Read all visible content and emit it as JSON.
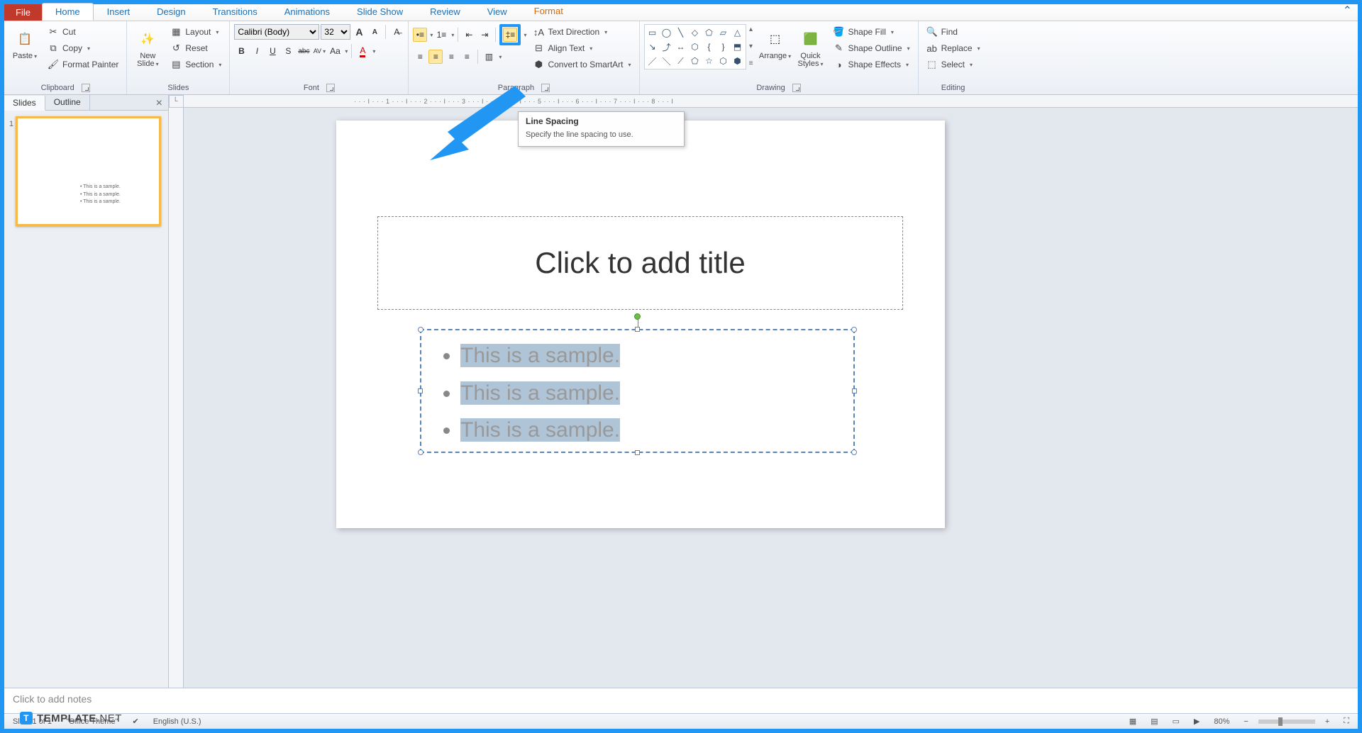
{
  "tabs": {
    "file": "File",
    "home": "Home",
    "insert": "Insert",
    "design": "Design",
    "transitions": "Transitions",
    "animations": "Animations",
    "slideshow": "Slide Show",
    "review": "Review",
    "view": "View",
    "format": "Format"
  },
  "clipboard": {
    "paste": "Paste",
    "cut": "Cut",
    "copy": "Copy",
    "format_painter": "Format Painter",
    "group": "Clipboard"
  },
  "slides": {
    "new_slide": "New\nSlide",
    "layout": "Layout",
    "reset": "Reset",
    "section": "Section",
    "group": "Slides"
  },
  "font": {
    "name": "Calibri (Body)",
    "size": "32",
    "grow": "A",
    "shrink": "A",
    "clear": "Aa",
    "bold": "B",
    "italic": "I",
    "underline": "U",
    "strike": "S",
    "strike2": "abc",
    "spacing": "AV",
    "case": "Aa",
    "color": "A",
    "group": "Font"
  },
  "paragraph": {
    "group": "Paragraph",
    "text_direction": "Text Direction",
    "align_text": "Align Text",
    "convert_smartart": "Convert to SmartArt"
  },
  "drawing": {
    "group": "Drawing",
    "arrange": "Arrange",
    "quick_styles": "Quick\nStyles",
    "shape_fill": "Shape Fill",
    "shape_outline": "Shape Outline",
    "shape_effects": "Shape Effects"
  },
  "editing": {
    "group": "Editing",
    "find": "Find",
    "replace": "Replace",
    "select": "Select"
  },
  "tooltip": {
    "title": "Line Spacing",
    "body": "Specify the line spacing to use."
  },
  "panel": {
    "slides": "Slides",
    "outline": "Outline"
  },
  "slide": {
    "title_placeholder": "Click to add title",
    "bullet1": "This is a sample.",
    "bullet2": "This is a sample.",
    "bullet3": "This is a sample."
  },
  "notes": {
    "placeholder": "Click to add notes"
  },
  "status": {
    "slide": "Slide 1 of 1",
    "theme": "\"Office Theme\"",
    "lang": "English (U.S.)",
    "zoom": "80%"
  },
  "ruler": {
    "marks": "· · · I · · · 1 · · · I · · · 2 · · · I · · · 3 · · · I · · · 4 · · · I · · · 5 · · · I · · · 6 · · · I · · · 7 · · · I · · · 8 · · · I"
  },
  "watermark": {
    "text": "TEMPLATE",
    "suffix": ".NET"
  }
}
